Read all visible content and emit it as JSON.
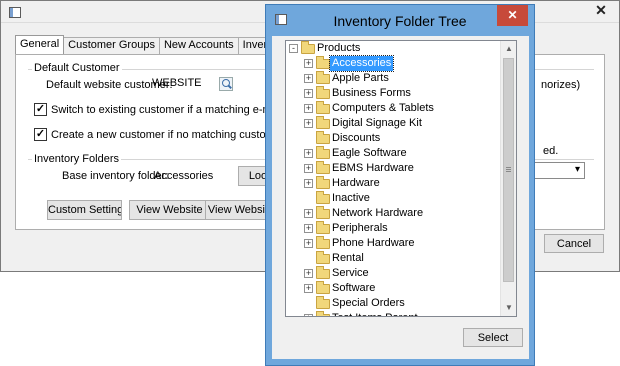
{
  "back_window": {
    "close_glyph": "✕",
    "tabs": [
      {
        "label": "General"
      },
      {
        "label": "Customer Groups"
      },
      {
        "label": "New Accounts"
      },
      {
        "label": "Inventory Settin"
      }
    ],
    "default_customer": {
      "title": "Default Customer",
      "label": "Default website customer:",
      "value": "WEBSITE"
    },
    "checkboxes": [
      {
        "label": "Switch to existing customer if a matching e-mail address",
        "checked": true
      },
      {
        "label": "Create a new customer if no matching customer is found",
        "checked": true
      }
    ],
    "inventory_folders": {
      "title": "Inventory Folders",
      "label": "Base inventory folder:",
      "value": "Accessories",
      "lookup_button": "Loo"
    },
    "buttons": {
      "custom_settings": "Custom Settings",
      "view_website_1": "View Website",
      "view_website_2": "View Website"
    },
    "right_fragments": {
      "authorizes": "norizes)",
      "ed": "ed."
    },
    "combo_arrow": "▾",
    "cancel": "Cancel"
  },
  "dialog": {
    "title": "Inventory Folder Tree",
    "close_glyph": "✕",
    "select_button": "Select",
    "tree": [
      {
        "label": "Products",
        "level": 0,
        "expander": "-",
        "selected": false
      },
      {
        "label": "Accessories",
        "level": 1,
        "expander": "+",
        "selected": true
      },
      {
        "label": "Apple Parts",
        "level": 1,
        "expander": "+",
        "selected": false
      },
      {
        "label": "Business Forms",
        "level": 1,
        "expander": "+",
        "selected": false
      },
      {
        "label": "Computers & Tablets",
        "level": 1,
        "expander": "+",
        "selected": false
      },
      {
        "label": "Digital Signage Kit",
        "level": 1,
        "expander": "+",
        "selected": false
      },
      {
        "label": "Discounts",
        "level": 1,
        "expander": "",
        "selected": false
      },
      {
        "label": "Eagle Software",
        "level": 1,
        "expander": "+",
        "selected": false
      },
      {
        "label": "EBMS Hardware",
        "level": 1,
        "expander": "+",
        "selected": false
      },
      {
        "label": "Hardware",
        "level": 1,
        "expander": "+",
        "selected": false
      },
      {
        "label": "Inactive",
        "level": 1,
        "expander": "",
        "selected": false
      },
      {
        "label": "Network Hardware",
        "level": 1,
        "expander": "+",
        "selected": false
      },
      {
        "label": "Peripherals",
        "level": 1,
        "expander": "+",
        "selected": false
      },
      {
        "label": "Phone Hardware",
        "level": 1,
        "expander": "+",
        "selected": false
      },
      {
        "label": "Rental",
        "level": 1,
        "expander": "",
        "selected": false
      },
      {
        "label": "Service",
        "level": 1,
        "expander": "+",
        "selected": false
      },
      {
        "label": "Software",
        "level": 1,
        "expander": "+",
        "selected": false
      },
      {
        "label": "Special Orders",
        "level": 1,
        "expander": "",
        "selected": false
      },
      {
        "label": "Test Items Parent",
        "level": 1,
        "expander": "+",
        "selected": false
      }
    ],
    "scroll_up": "▲",
    "scroll_down": "▼"
  },
  "colors": {
    "dialog_frame": "#6fa7dc",
    "close_button": "#c74a3a",
    "selection": "#3399ff",
    "folder": "#f1d77b"
  }
}
